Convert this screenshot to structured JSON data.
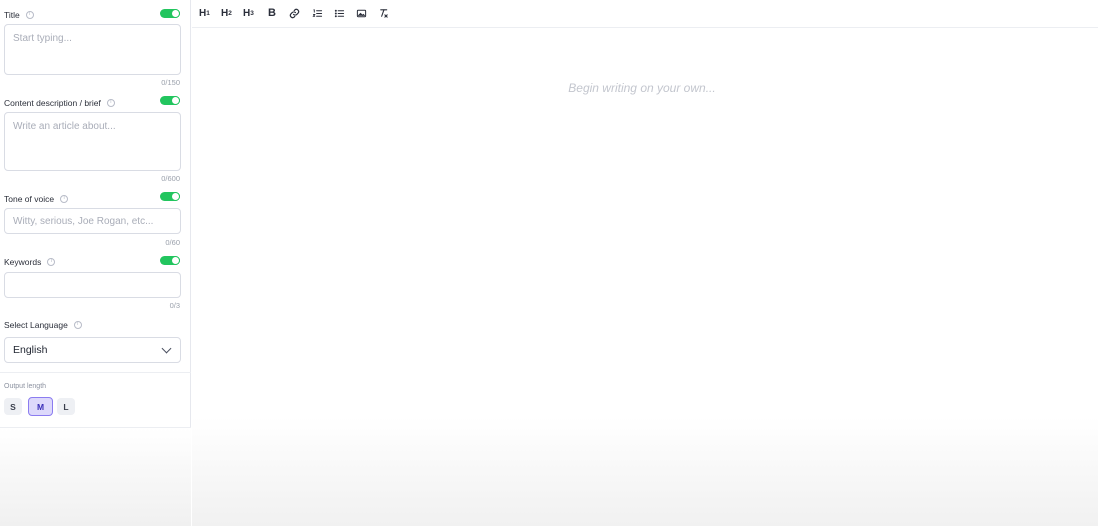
{
  "sidebar": {
    "title_field": {
      "label": "Title",
      "placeholder": "Start typing...",
      "counter": "0/150",
      "enabled": true
    },
    "description_field": {
      "label": "Content description / brief",
      "placeholder": "Write an article about...",
      "counter": "0/600",
      "enabled": true
    },
    "tone_field": {
      "label": "Tone of voice",
      "placeholder": "Witty, serious, Joe Rogan, etc...",
      "counter": "0/60",
      "enabled": true
    },
    "keywords_field": {
      "label": "Keywords",
      "placeholder": "",
      "counter": "0/3",
      "enabled": true
    },
    "language_field": {
      "label": "Select Language",
      "selected": "English"
    },
    "output_length": {
      "label": "Output length",
      "options": [
        "S",
        "M",
        "L"
      ],
      "selected": "M"
    }
  },
  "toolbar": {
    "h1": "H",
    "h1_sub": "1",
    "h2": "H",
    "h2_sub": "2",
    "h3": "H",
    "h3_sub": "3",
    "bold": "B",
    "icons": [
      "link-icon",
      "ordered-list-icon",
      "bullet-list-icon",
      "image-icon",
      "clear-format-icon"
    ]
  },
  "editor": {
    "placeholder": "Begin writing on your own..."
  },
  "colors": {
    "toggle_on": "#22c55e",
    "selected_accent": "#8b7cf0",
    "selected_bg": "#ddd9fb"
  }
}
